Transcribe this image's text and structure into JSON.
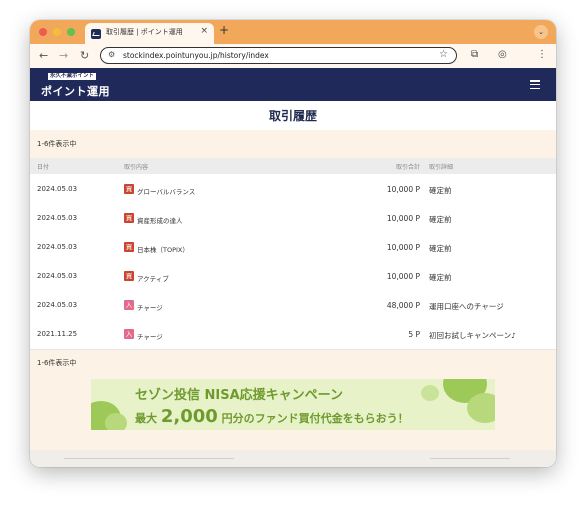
{
  "browser": {
    "tab_title": "取引履歴 | ポイント運用",
    "tab_close": "×",
    "new_tab": "+",
    "tab_menu": "⌄",
    "url": "stockindex.pointunyou.jp/history/index",
    "nav": {
      "back": "←",
      "forward": "→",
      "reload": "↻"
    }
  },
  "site": {
    "logo_tag": "永久不滅ポイント",
    "logo_main": "ポイント運用"
  },
  "page": {
    "title": "取引履歴",
    "count_top": "1-6件表示中",
    "count_bottom": "1-6件表示中"
  },
  "table": {
    "headers": {
      "date": "日付",
      "content": "取引内容",
      "amount": "取引合計",
      "detail": "取引詳細"
    },
    "rows": [
      {
        "date": "2024.05.03",
        "badge": "買",
        "badge_color": "#c9452f",
        "content": "グローバルバランス",
        "amount": "10,000 P",
        "detail": "確定前"
      },
      {
        "date": "2024.05.03",
        "badge": "買",
        "badge_color": "#c9452f",
        "content": "資産形成の達人",
        "amount": "10,000 P",
        "detail": "確定前"
      },
      {
        "date": "2024.05.03",
        "badge": "買",
        "badge_color": "#c9452f",
        "content": "日本株（TOPIX）",
        "amount": "10,000 P",
        "detail": "確定前"
      },
      {
        "date": "2024.05.03",
        "badge": "買",
        "badge_color": "#c9452f",
        "content": "アクティブ",
        "amount": "10,000 P",
        "detail": "確定前"
      },
      {
        "date": "2024.05.03",
        "badge": "入",
        "badge_color": "#e26a8b",
        "content": "チャージ",
        "amount": "48,000 P",
        "detail": "運用口座へのチャージ"
      },
      {
        "date": "2021.11.25",
        "badge": "入",
        "badge_color": "#e26a8b",
        "content": "チャージ",
        "amount": "5 P",
        "detail": "初回お試しキャンペーン♪"
      }
    ]
  },
  "banner": {
    "line1": "セゾン投信 NISA応援キャンペーン",
    "line2_prefix": "最大",
    "line2_amount": "2,000",
    "line2_suffix": "円分のファンド買付代金をもらおう！"
  },
  "colors": {
    "tabstrip": "#f2a85a",
    "header": "#1f2a5b",
    "highlight": "#fcf3e6"
  }
}
